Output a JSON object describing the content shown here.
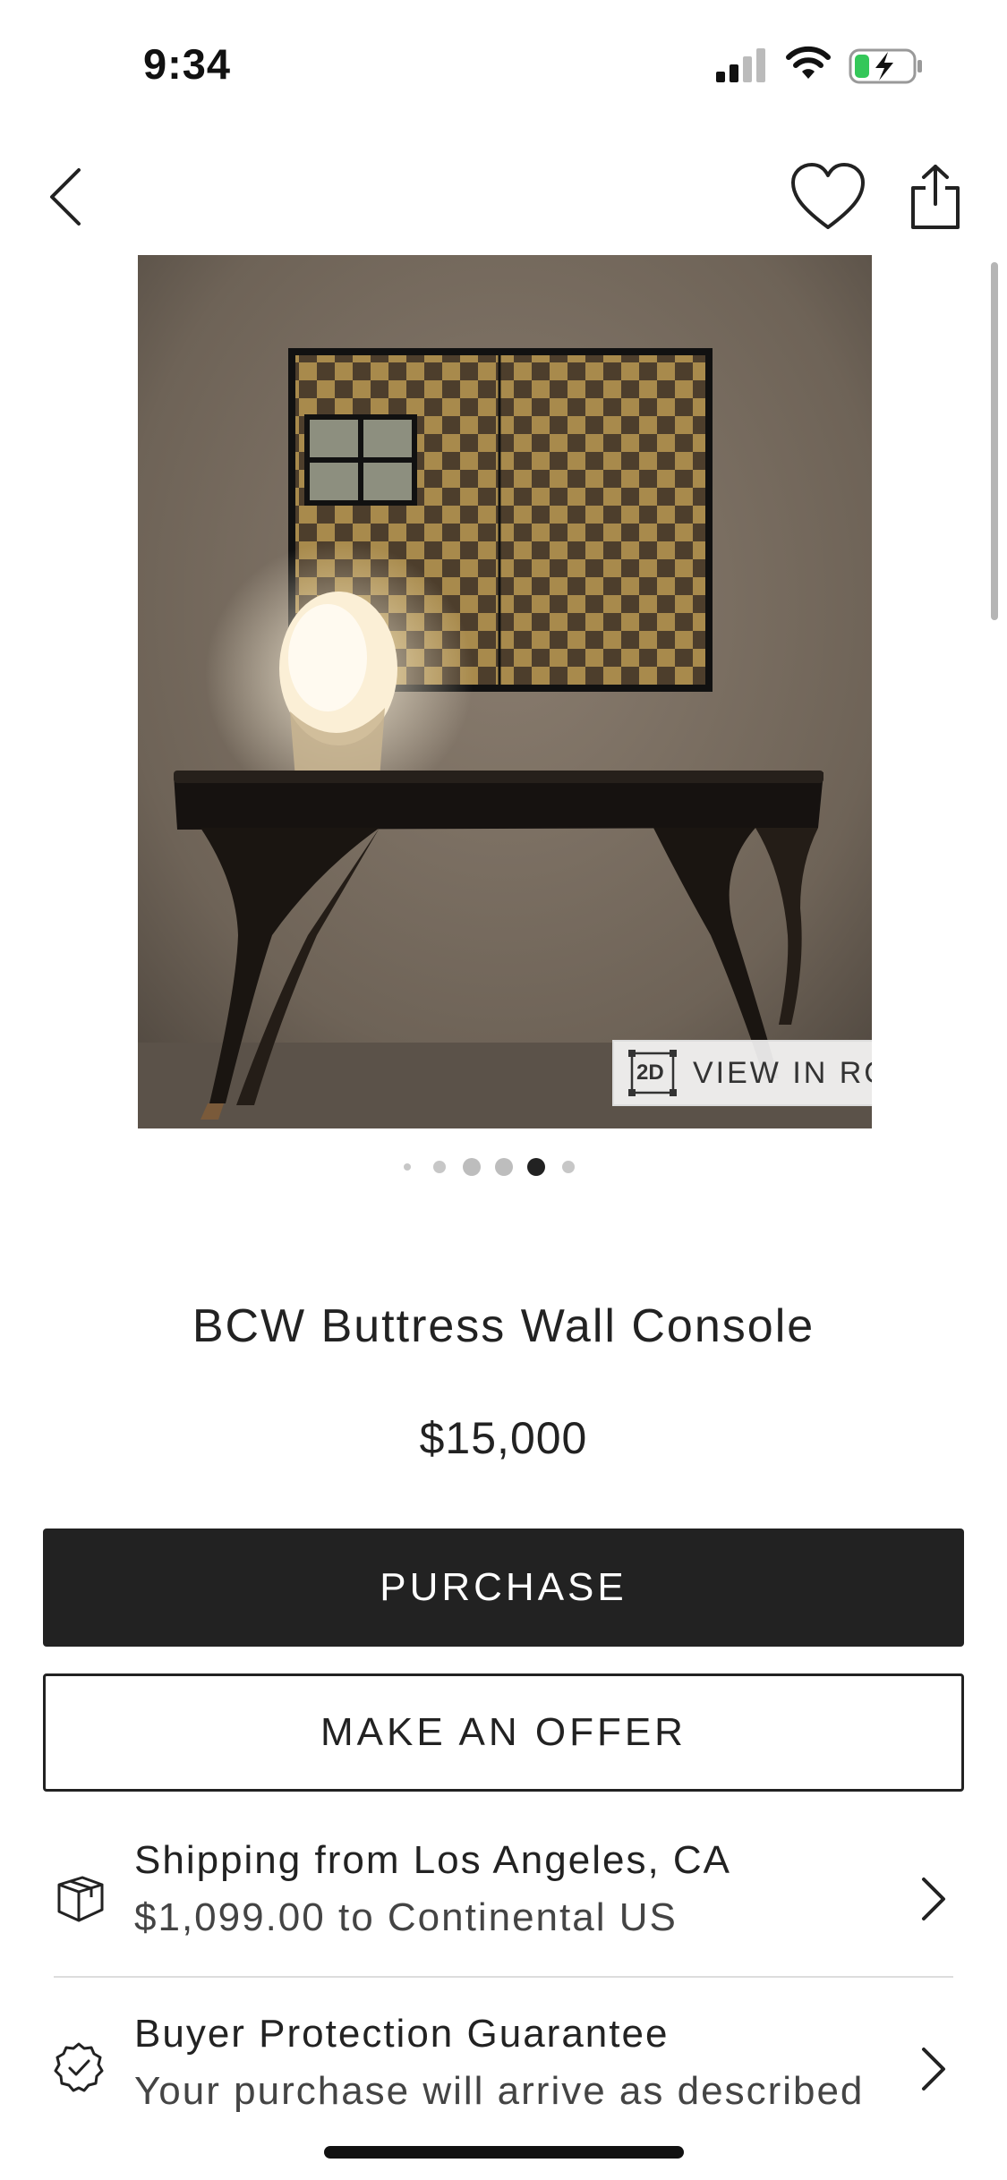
{
  "status_bar": {
    "time": "9:34"
  },
  "nav": {
    "back_icon": "chevron-left-icon",
    "favorite_icon": "heart-icon",
    "share_icon": "share-icon"
  },
  "product": {
    "image_alt": "console table with lamp and checkered wall art",
    "view_in_room": {
      "badge": "2D",
      "label": "VIEW IN ROOM"
    },
    "pager": {
      "count": 6,
      "active_index": 4
    },
    "title": "BCW Buttress Wall Console",
    "price": "$15,000"
  },
  "actions": {
    "purchase_label": "PURCHASE",
    "offer_label": "MAKE AN OFFER"
  },
  "shipping": {
    "title": "Shipping from Los Angeles, CA",
    "subtitle": "$1,099.00 to Continental US",
    "icon": "package-icon"
  },
  "protection": {
    "title": "Buyer Protection Guarantee",
    "subtitle": "Your purchase will arrive as described",
    "icon": "check-badge-icon"
  },
  "colors": {
    "primary": "#222222",
    "divider": "#dddddd"
  }
}
